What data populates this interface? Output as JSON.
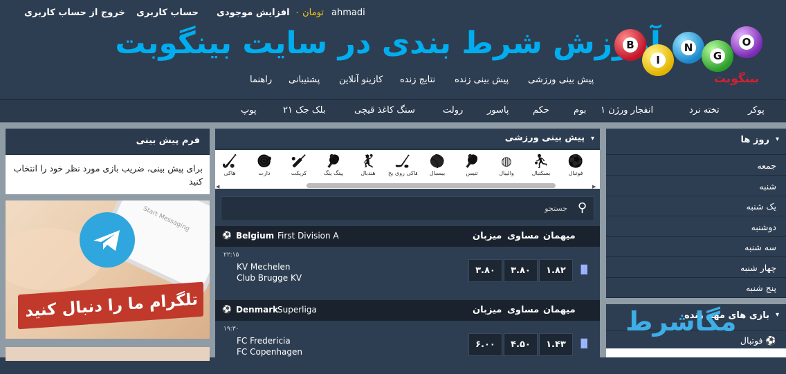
{
  "header": {
    "logout": "خروج از حساب کاربری",
    "account": "حساب کاربری",
    "topup": "افزایش موجودی",
    "balance": "تومان ۰",
    "username": "ahmadi",
    "banner_title": "آموزش شرط بندی در سایت بینگوبت",
    "logo_balls": [
      "B",
      "I",
      "N",
      "G",
      "O"
    ],
    "logo_subtitle": "بینگوبت"
  },
  "main_nav": [
    "پیش بینی ورزشی",
    "پیش بینی زنده",
    "نتایج زنده",
    "کازینو آنلاین",
    "پشتیبانی",
    "راهنما"
  ],
  "sub_nav": [
    "پوکر",
    "تخته نرد",
    "انفجار ورژن ۱",
    "بوم",
    "حکم",
    "پاسور",
    "رولت",
    "سنگ کاغذ قیچی",
    "بلک جک ۲۱",
    "پوپ"
  ],
  "left": {
    "form_title": "فرم پیش بینی",
    "form_text": "برای پیش بینی، ضریب بازی مورد نظر خود را انتخاب کنید",
    "telegram_text": "تلگرام ما را دنبال کنید",
    "phone_text": "Start Messaging"
  },
  "center": {
    "title": "پیش بینی ورزشی",
    "search_placeholder": "جستجو",
    "sports": [
      {
        "label": "فوتبال",
        "icon": "soccer-icon",
        "glyph": "⚽"
      },
      {
        "label": "بسکتبال",
        "icon": "basketball-hoop-icon",
        "glyph": "⛹"
      },
      {
        "label": "والیبال",
        "icon": "volleyball-icon",
        "glyph": "◍"
      },
      {
        "label": "تنیس",
        "icon": "table-tennis-icon",
        "glyph": "🏓"
      },
      {
        "label": "بیسبال",
        "icon": "baseball-icon",
        "glyph": "⚾"
      },
      {
        "label": "هاکی روی یخ",
        "icon": "ice-hockey-icon",
        "glyph": "🏒"
      },
      {
        "label": "هندبال",
        "icon": "handball-icon",
        "glyph": "🤾"
      },
      {
        "label": "پینگ پنگ",
        "icon": "ping-pong-icon",
        "glyph": "🏓"
      },
      {
        "label": "کریکت",
        "icon": "cricket-icon",
        "glyph": "🏏"
      },
      {
        "label": "دارت",
        "icon": "darts-icon",
        "glyph": "🎯"
      },
      {
        "label": "هاکی",
        "icon": "field-hockey-icon",
        "glyph": "🏑"
      }
    ],
    "col_home": "میزبان",
    "col_draw": "مساوی",
    "col_away": "میهمان",
    "leagues": [
      {
        "country": "Belgium",
        "name": "First Division A",
        "time": "۲۲:۱۵",
        "home": "KV Mechelen",
        "away": "Club Brugge KV",
        "odds": [
          "۳.۸۰",
          "۳.۸۰",
          "۱.۸۲"
        ]
      },
      {
        "country": "Denmark",
        "name": "Superliga",
        "time": "۱۹:۳۰",
        "home": "FC Fredericia",
        "away": "FC Copenhagen",
        "odds": [
          "۶.۰۰",
          "۴.۵۰",
          "۱.۴۳"
        ]
      }
    ]
  },
  "right": {
    "days_title": "روز ها",
    "days": [
      "جمعه",
      "شنبه",
      "یک شنبه",
      "دوشنبه",
      "سه شنبه",
      "چهار شنبه",
      "پنج شنبه"
    ],
    "live_title": "بازی های مهم زنده",
    "live_sport": "فوتبال",
    "watermark": "مگاشرط"
  },
  "colors": {
    "accent": "#00aeef",
    "bg": "#2e3e52",
    "gold": "#f2c811"
  }
}
